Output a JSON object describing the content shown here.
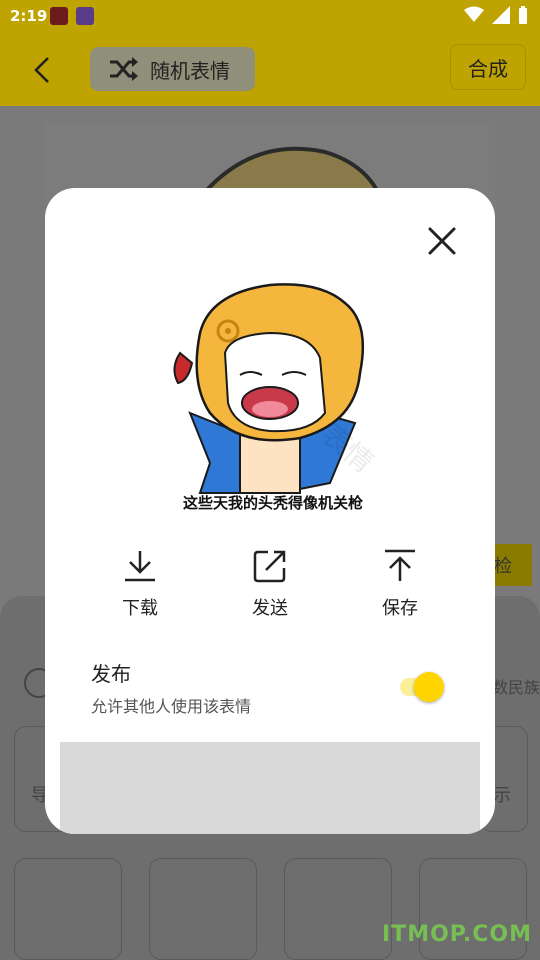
{
  "status_bar": {
    "time": "2:19"
  },
  "app_bar": {
    "random_label": "随机表情",
    "compose_label": "合成"
  },
  "background": {
    "check_label": "检",
    "right_hint": "数民族",
    "box_left_hint": "导",
    "box_right_hint": "示"
  },
  "modal": {
    "meme_caption": "这些天我的头秃得像机关枪",
    "actions": [
      {
        "label": "下载",
        "icon": "download-icon"
      },
      {
        "label": "发送",
        "icon": "share-icon"
      },
      {
        "label": "保存",
        "icon": "upload-icon"
      }
    ],
    "publish": {
      "title": "发布",
      "description": "允许其他人使用该表情",
      "enabled": true
    }
  },
  "watermark": "ITMOP.COM",
  "colors": {
    "accent_yellow": "#ffd500",
    "app_bar_dimmed": "#bfa300",
    "modal_bg": "#ffffff"
  }
}
